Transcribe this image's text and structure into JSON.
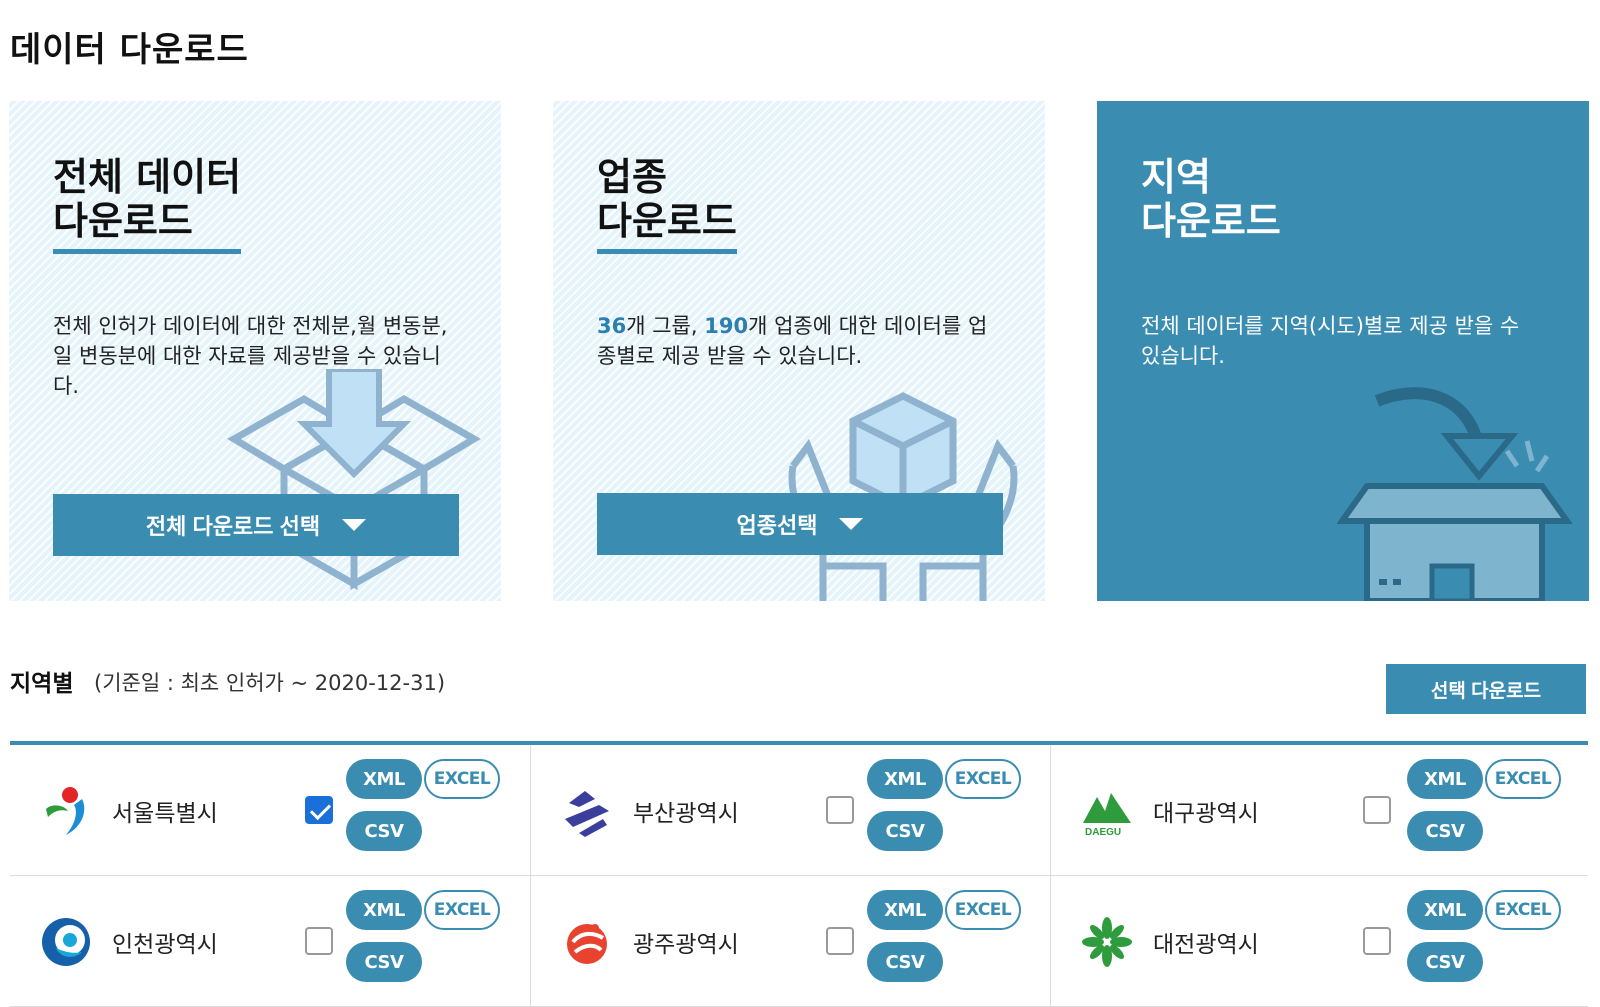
{
  "page": {
    "title": "데이터 다운로드"
  },
  "cards": [
    {
      "title": "전체 데이터\n다운로드",
      "desc": "전체 인허가 데이터에 대한 전체분,월 변동분, 일 변동분에 대한 자료를 제공받을 수 있습니다.",
      "button": "전체 다운로드 선택",
      "icon": "box-download-icon"
    },
    {
      "title": "업종\n다운로드",
      "desc_parts": {
        "n1": "36",
        "t1": "개 그룹, ",
        "n2": "190",
        "t2": "개 업종에 대한 데이터를 업종별로 제공 받을 수 있습니다."
      },
      "button": "업종선택",
      "icon": "hands-cube-icon"
    },
    {
      "title": "지역\n다운로드",
      "desc": "전체 데이터를 지역(시도)별로 제공 받을 수 있습니다.",
      "icon": "house-arrow-icon"
    }
  ],
  "region": {
    "heading": "지역별",
    "subtitle": "(기준일 : 최초 인허가 ~ 2020-12-31)",
    "select_button": "선택 다운로드",
    "format_labels": {
      "xml": "XML",
      "excel": "EXCEL",
      "csv": "CSV"
    },
    "items": [
      {
        "name": "서울특별시",
        "checked": true,
        "logo": "seoul-logo-icon"
      },
      {
        "name": "부산광역시",
        "checked": false,
        "logo": "busan-logo-icon"
      },
      {
        "name": "대구광역시",
        "checked": false,
        "logo": "daegu-logo-icon",
        "logo_text": "DAEGU"
      },
      {
        "name": "인천광역시",
        "checked": false,
        "logo": "incheon-logo-icon"
      },
      {
        "name": "광주광역시",
        "checked": false,
        "logo": "gwangju-logo-icon"
      },
      {
        "name": "대전광역시",
        "checked": false,
        "logo": "daejeon-logo-icon"
      }
    ]
  },
  "colors": {
    "accent": "#3a8db1",
    "card_bg": "#e5f4fa",
    "checkbox_on": "#1a6fd9"
  }
}
